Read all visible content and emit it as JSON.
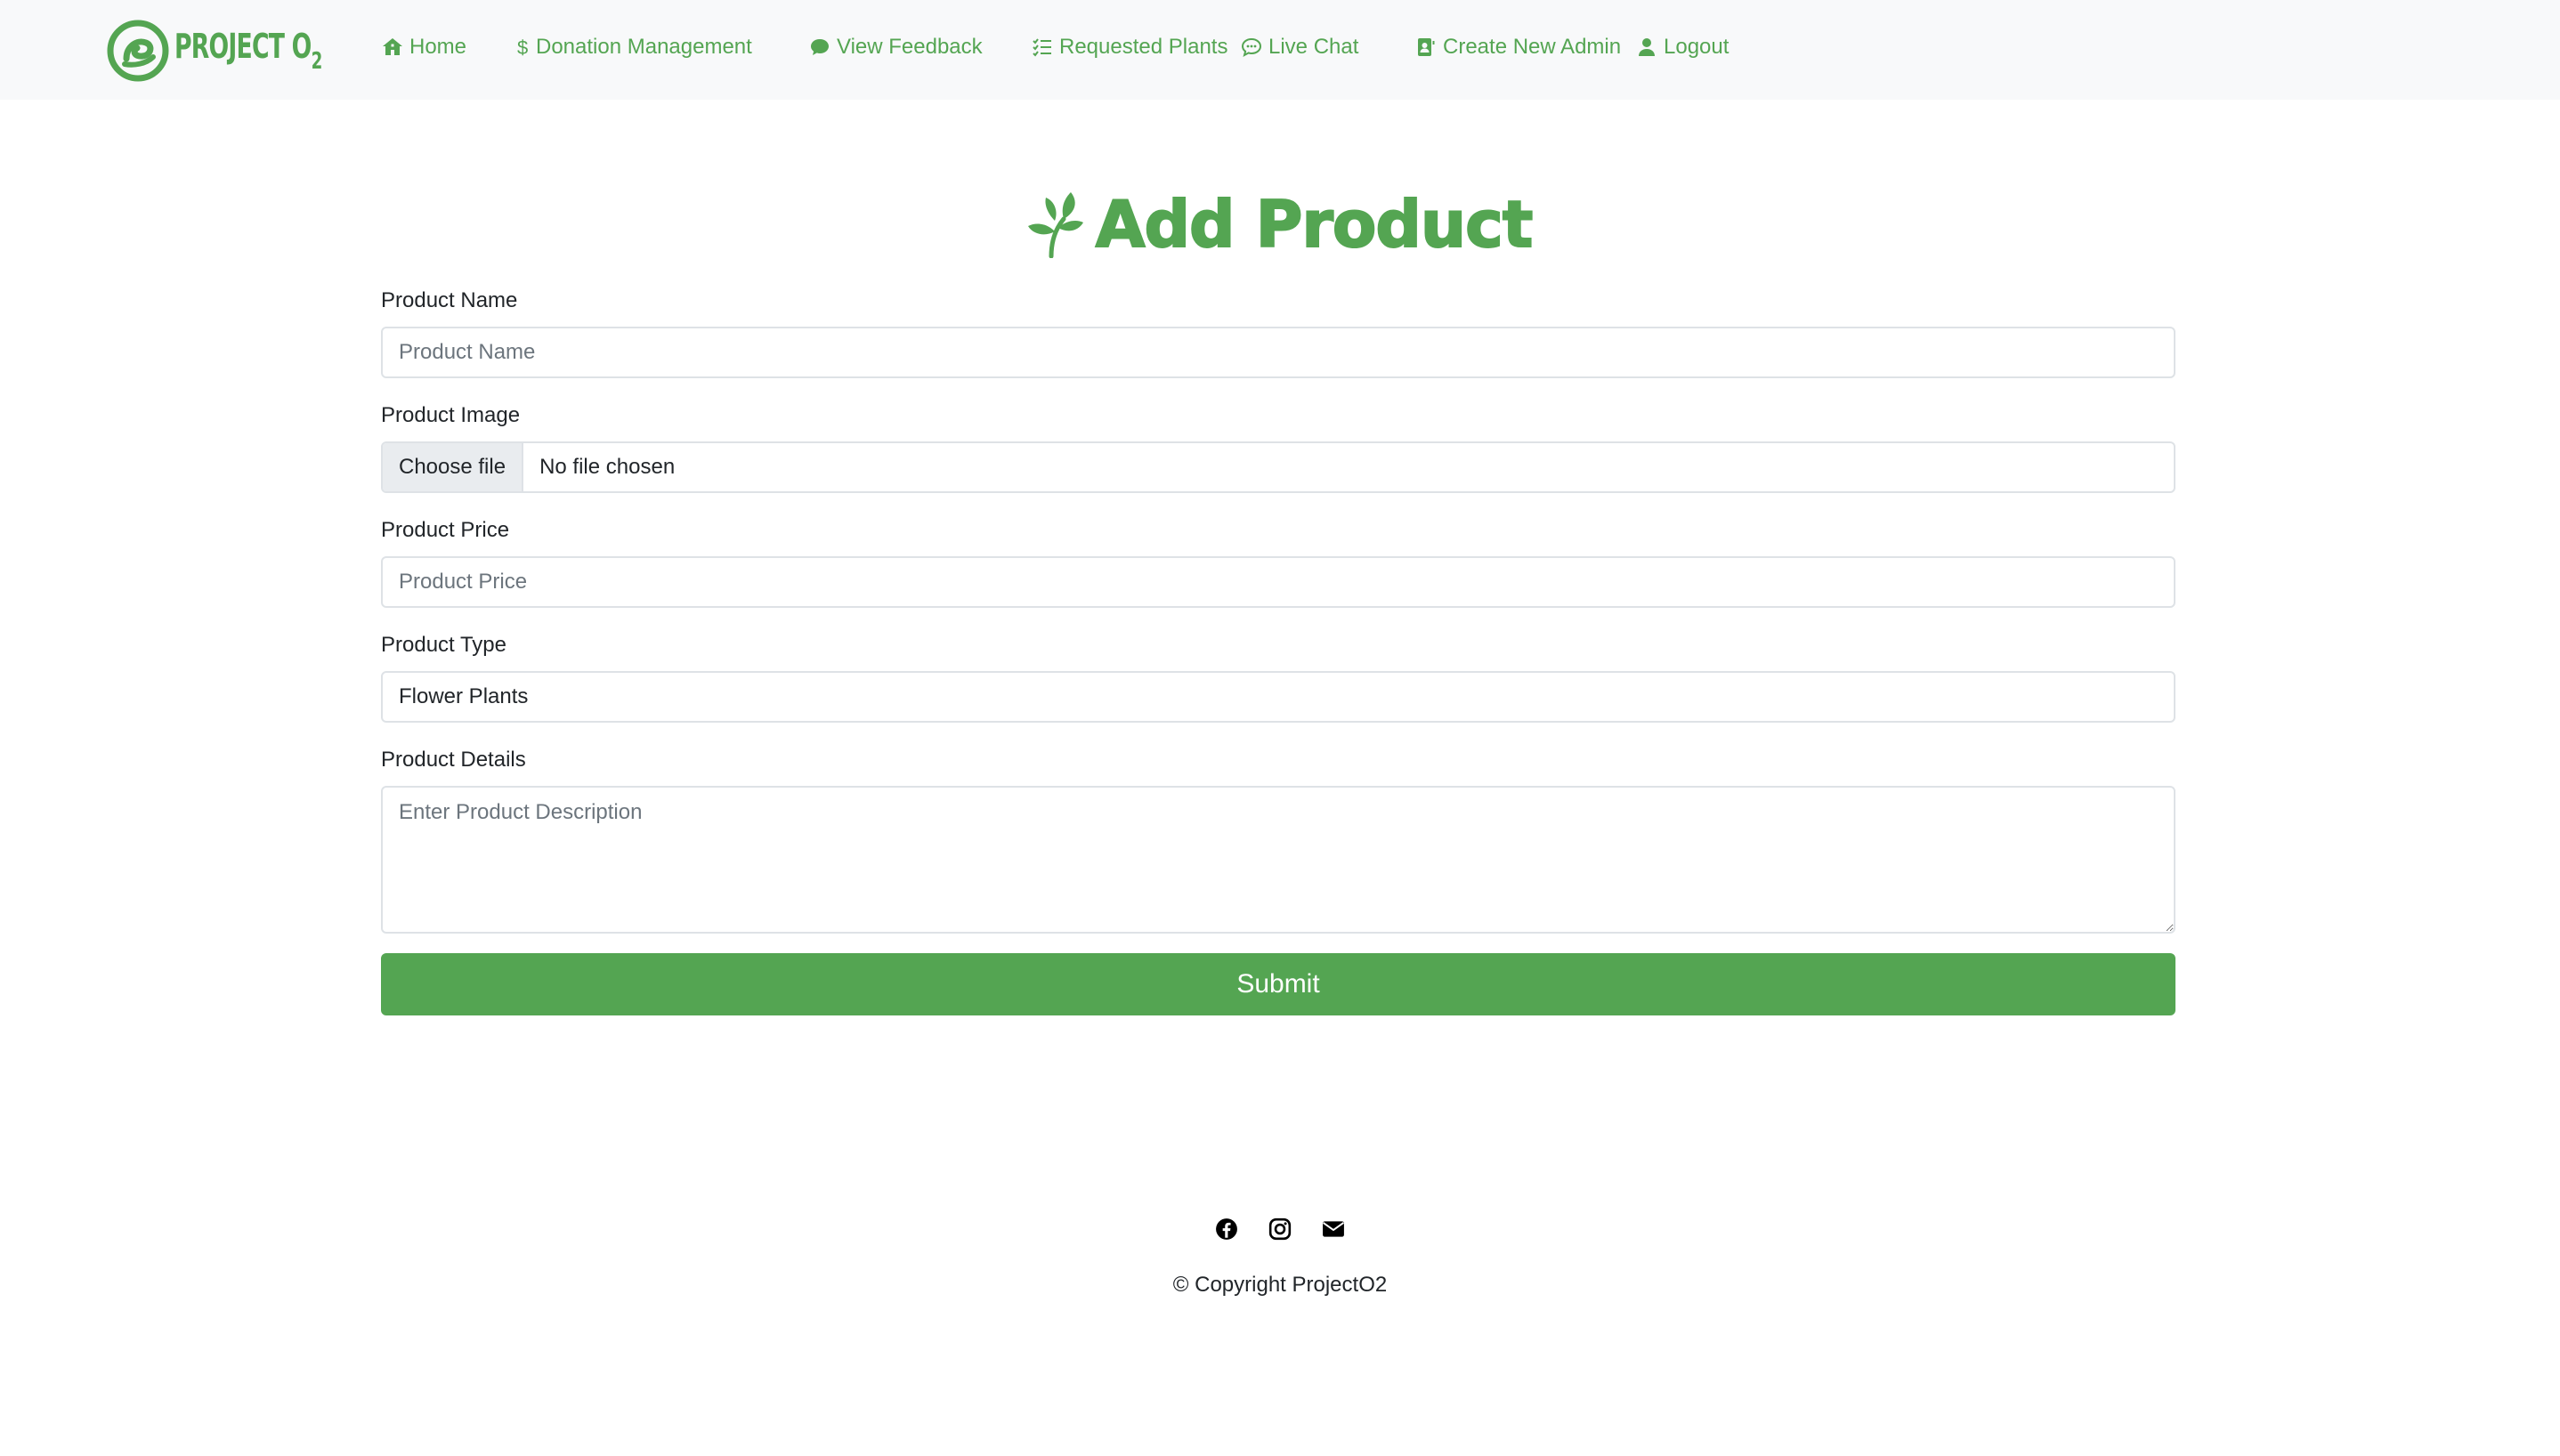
{
  "colors": {
    "accent": "#54a552",
    "navbar_bg": "#f8f9fa",
    "border": "#dee2e6",
    "placeholder": "#6c757d"
  },
  "brand": {
    "name": "PROJECT O",
    "subscript": "2",
    "icon": "project-o2-logo-icon"
  },
  "nav": {
    "items": [
      {
        "label": "Home",
        "icon": "house-icon"
      },
      {
        "label": "Donation Management",
        "icon": "dollar-icon"
      },
      {
        "label": "View Feedback",
        "icon": "chat-bubble-icon"
      },
      {
        "label": "Requested Plants",
        "icon": "checklist-icon"
      },
      {
        "label": "Live Chat",
        "icon": "chat-dots-icon"
      },
      {
        "label": "Create New Admin",
        "icon": "person-badge-icon"
      },
      {
        "label": "Logout",
        "icon": "person-icon"
      }
    ]
  },
  "page": {
    "title": "Add Product",
    "title_icon": "leaf-sprout-icon"
  },
  "form": {
    "product_name": {
      "label": "Product Name",
      "placeholder": "Product Name",
      "value": ""
    },
    "product_image": {
      "label": "Product Image",
      "button": "Choose file",
      "status": "No file chosen"
    },
    "product_price": {
      "label": "Product Price",
      "placeholder": "Product Price",
      "value": ""
    },
    "product_type": {
      "label": "Product Type",
      "value": "Flower Plants"
    },
    "product_details": {
      "label": "Product Details",
      "placeholder": "Enter Product Description",
      "value": ""
    },
    "submit_label": "Submit"
  },
  "footer": {
    "icons": [
      "facebook-icon",
      "instagram-icon",
      "envelope-icon"
    ],
    "copyright": "© Copyright ProjectO2"
  }
}
